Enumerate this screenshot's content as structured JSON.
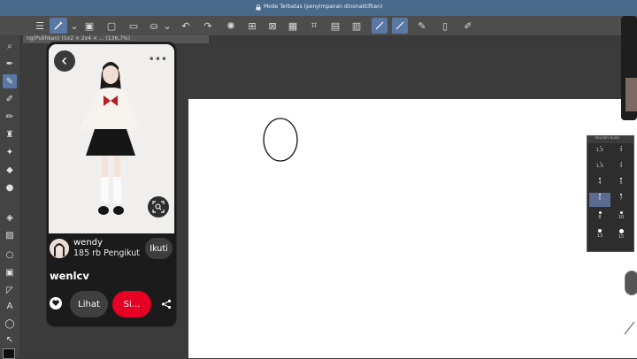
{
  "window": {
    "title": "Mode Terbatas (penyimpanan dinonaktifkan)"
  },
  "document_tab": {
    "label": "ng(Pulihkan) (5x2 × 2x4 × ... (136,7%)"
  },
  "toolbar": {
    "icons": [
      "menu-icon",
      "select-icon",
      "chevron-down-icon",
      "layer-icon",
      "new-icon",
      "open-icon",
      "save-icon",
      "export-icon",
      "undo-icon",
      "redo-icon",
      "settings-icon",
      "grid-icon",
      "transform-icon",
      "clear-icon",
      "crop-icon",
      "pen-icon",
      "pencil-active-icon",
      "edit-icon",
      "phone-icon",
      "edit-check-icon"
    ]
  },
  "left_tools": [
    "select-icon",
    "spark-icon",
    "eyedropper-icon",
    "pen-icon",
    "brush-icon",
    "pencil-icon",
    "fill-icon",
    "sparkle-icon",
    "eraser-icon",
    "water-icon",
    "bucket-icon",
    "gradient-icon",
    "shape-circle-icon",
    "frame-icon",
    "ruler-icon",
    "text-icon",
    "balloon-icon",
    "move-icon",
    "color-icon"
  ],
  "pinterest": {
    "user_name": "wendy",
    "followers": "185 rb Pengikut",
    "follow_label": "Ikuti",
    "pin_title": "wenlcv",
    "view_label": "Lihat",
    "save_label": "Si...",
    "accent": "#e60023"
  },
  "brush_size_panel": {
    "header": "Ukuran kuas",
    "sizes": [
      "1,5",
      "3",
      "1,5",
      "3",
      "4",
      "5",
      "6",
      "7",
      "8",
      "10",
      "13",
      "15"
    ],
    "selected": "6"
  }
}
